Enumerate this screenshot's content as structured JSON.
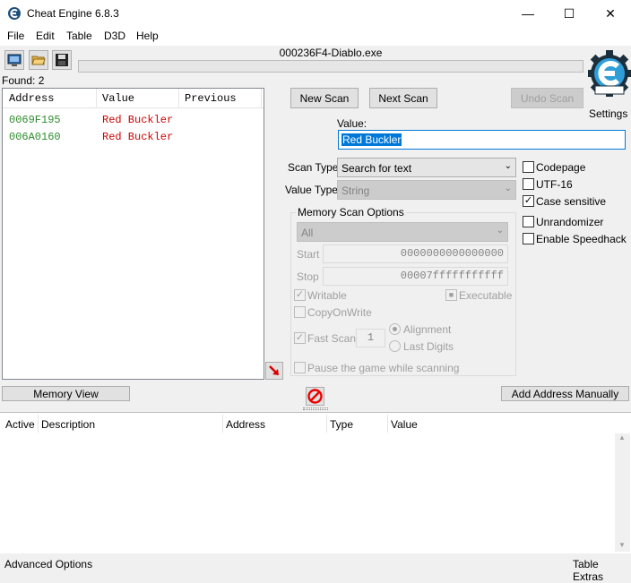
{
  "window": {
    "title": "Cheat Engine 6.8.3"
  },
  "menu": {
    "file": "File",
    "edit": "Edit",
    "table": "Table",
    "d3d": "D3D",
    "help": "Help"
  },
  "process": {
    "title": "000236F4-Diablo.exe"
  },
  "found_label": "Found: 2",
  "results": {
    "headers": {
      "address": "Address",
      "value": "Value",
      "previous": "Previous"
    },
    "rows": [
      {
        "address": "0069F195",
        "value": "Red Buckler",
        "previous": ""
      },
      {
        "address": "006A0160",
        "value": "Red Buckler",
        "previous": ""
      }
    ]
  },
  "buttons": {
    "new_scan": "New Scan",
    "next_scan": "Next Scan",
    "undo_scan": "Undo Scan",
    "settings": "Settings",
    "memory_view": "Memory View",
    "add_address_manually": "Add Address Manually"
  },
  "scan": {
    "value_label": "Value:",
    "value": "Red Buckler",
    "scan_type_label": "Scan Type",
    "scan_type": "Search for text",
    "value_type_label": "Value Type",
    "value_type": "String"
  },
  "options": {
    "codepage": {
      "label": "Codepage",
      "checked": false
    },
    "utf16": {
      "label": "UTF-16",
      "checked": false
    },
    "case_sensitive": {
      "label": "Case sensitive",
      "checked": true
    },
    "unrandomizer": {
      "label": "Unrandomizer",
      "checked": false
    },
    "enable_speedhack": {
      "label": "Enable Speedhack",
      "checked": false
    }
  },
  "memory_scan": {
    "group_label": "Memory Scan Options",
    "region": "All",
    "start_label": "Start",
    "start": "0000000000000000",
    "stop_label": "Stop",
    "stop": "00007fffffffffff",
    "writable": "Writable",
    "executable": "Executable",
    "copy_on_write": "CopyOnWrite",
    "fast_scan": "Fast Scan",
    "fast_scan_value": "1",
    "alignment": "Alignment",
    "last_digits": "Last Digits",
    "pause_game": "Pause the game while scanning"
  },
  "address_table": {
    "headers": {
      "active": "Active",
      "description": "Description",
      "address": "Address",
      "type": "Type",
      "value": "Value"
    }
  },
  "status": {
    "advanced_options": "Advanced Options",
    "table_extras": "Table Extras"
  },
  "colors": {
    "address_green": "#2e8b2e",
    "value_red": "#d00000",
    "selection_blue": "#0078d7"
  },
  "icons": [
    "cheat-engine-icon",
    "select-process-icon",
    "open-file-icon",
    "save-file-icon",
    "arrow-down-red-icon",
    "stop-icon"
  ]
}
